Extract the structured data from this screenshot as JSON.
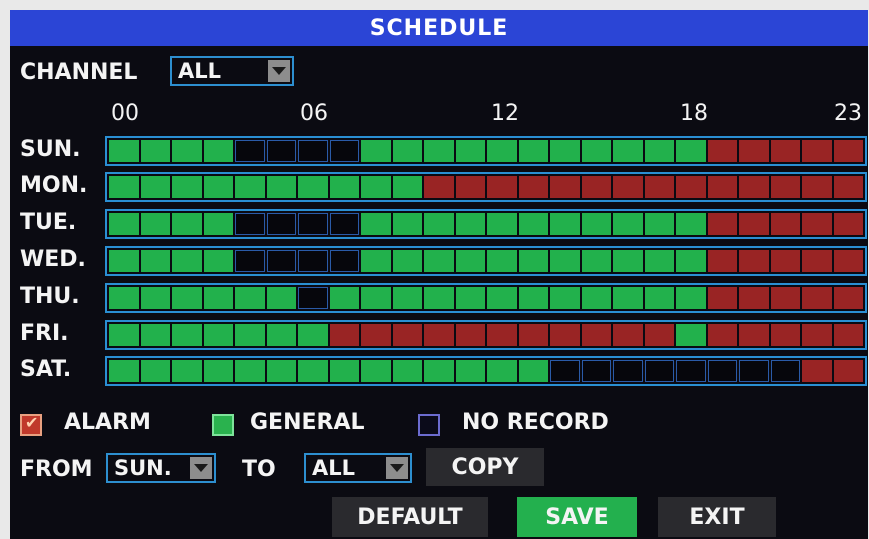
{
  "title": "SCHEDULE",
  "channel": {
    "label": "CHANNEL",
    "value": "ALL"
  },
  "hours": [
    "00",
    "06",
    "12",
    "18",
    "23"
  ],
  "colors": {
    "alarm": "#992424",
    "general": "#22b14c",
    "no_record": "#06060c",
    "title_bar": "#2b45d6"
  },
  "days": [
    {
      "label": "SUN.",
      "cells": "GGGGNNNNGGGGGGGGGGGAAAAA"
    },
    {
      "label": "MON.",
      "cells": "GGGGGGGGGGAAAAAAAAAAAAAA"
    },
    {
      "label": "TUE.",
      "cells": "GGGGNNNNGGGGGGGGGGGAAAAA"
    },
    {
      "label": "WED.",
      "cells": "GGGGNNNNGGGGGGGGGGGAAAAA"
    },
    {
      "label": "THU.",
      "cells": "GGGGGGNGGGGGGGGGGGGAAAAA"
    },
    {
      "label": "FRI.",
      "cells": "GGGGGGGAAAAAAAAAAAGAAAAA"
    },
    {
      "label": "SAT.",
      "cells": "GGGGGGGGGGGGGGNNNNNNNNAA"
    }
  ],
  "legend": {
    "alarm": "ALARM",
    "general": "GENERAL",
    "no_record": "NO RECORD"
  },
  "copy_row": {
    "from_label": "FROM",
    "from_value": "SUN.",
    "to_label": "TO",
    "to_value": "ALL",
    "copy_button": "COPY"
  },
  "buttons": {
    "default": "DEFAULT",
    "save": "SAVE",
    "exit": "EXIT"
  }
}
